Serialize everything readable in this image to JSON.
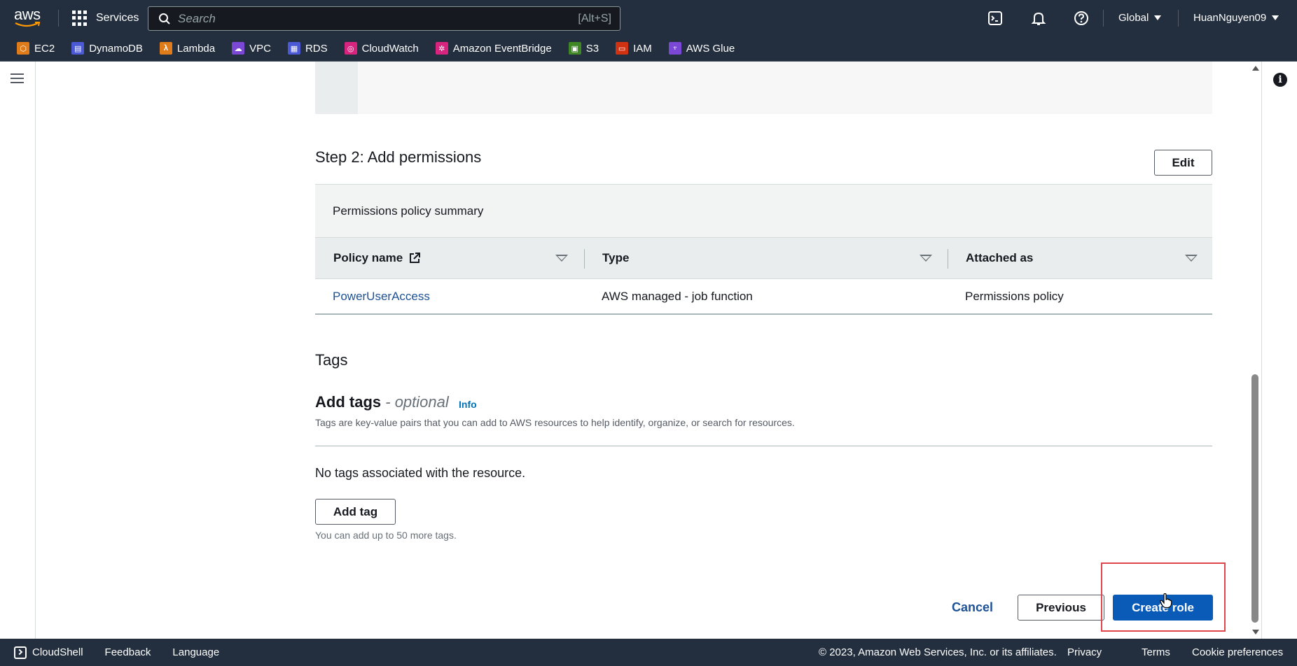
{
  "topnav": {
    "logo_text": "aws",
    "services_label": "Services",
    "search_placeholder": "Search",
    "search_shortcut": "[Alt+S]",
    "region_label": "Global",
    "account_label": "HuanNguyen09"
  },
  "favorites": [
    {
      "label": "EC2",
      "color": "#e07b1a",
      "glyph": "⬡"
    },
    {
      "label": "DynamoDB",
      "color": "#4c59d4",
      "glyph": "▤"
    },
    {
      "label": "Lambda",
      "color": "#e07b1a",
      "glyph": "λ"
    },
    {
      "label": "VPC",
      "color": "#7b48d6",
      "glyph": "☁"
    },
    {
      "label": "RDS",
      "color": "#4c59d4",
      "glyph": "▦"
    },
    {
      "label": "CloudWatch",
      "color": "#d6247f",
      "glyph": "◎"
    },
    {
      "label": "Amazon EventBridge",
      "color": "#d6247f",
      "glyph": "✲"
    },
    {
      "label": "S3",
      "color": "#3f8624",
      "glyph": "▣"
    },
    {
      "label": "IAM",
      "color": "#d13212",
      "glyph": "▭"
    },
    {
      "label": "AWS Glue",
      "color": "#7b48d6",
      "glyph": "♆"
    }
  ],
  "step2": {
    "title": "Step 2: Add permissions",
    "edit_label": "Edit",
    "summary_title": "Permissions policy summary",
    "columns": [
      "Policy name",
      "Type",
      "Attached as"
    ],
    "rows": [
      {
        "policy_name": "PowerUserAccess",
        "type": "AWS managed - job function",
        "attached_as": "Permissions policy"
      }
    ]
  },
  "tags": {
    "title": "Tags",
    "add_tags_title": "Add tags",
    "optional_suffix": "- optional",
    "info_label": "Info",
    "description": "Tags are key-value pairs that you can add to AWS resources to help identify, organize, or search for resources.",
    "empty_text": "No tags associated with the resource.",
    "add_tag_label": "Add tag",
    "hint": "You can add up to 50 more tags."
  },
  "actions": {
    "cancel_label": "Cancel",
    "previous_label": "Previous",
    "create_label": "Create role"
  },
  "footer": {
    "cloudshell_label": "CloudShell",
    "feedback_label": "Feedback",
    "language_label": "Language",
    "copyright": "© 2023, Amazon Web Services, Inc. or its affiliates.",
    "privacy_label": "Privacy",
    "terms_label": "Terms",
    "cookie_label": "Cookie preferences"
  },
  "colors": {
    "nav_bg": "#232f3e",
    "primary_button": "#0a5bb8",
    "link": "#1d5296",
    "highlight": "#e0454b"
  }
}
